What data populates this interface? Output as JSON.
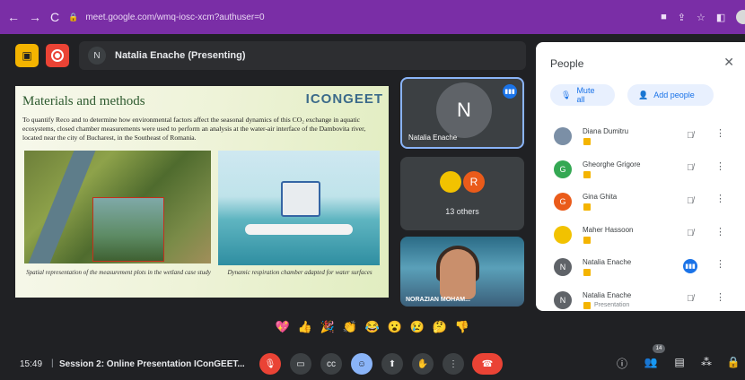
{
  "browser": {
    "url": "meet.google.com/wmq-iosc-xcm?authuser=0",
    "back": "←",
    "forward": "→",
    "reload": "C"
  },
  "meet": {
    "presenter_initial": "N",
    "presenter_label": "Natalia Enache (Presenting)"
  },
  "slide": {
    "title": "Materials and methods",
    "logo": "ICONGEET",
    "body": "To quantify Reco and to determine how environmental factors affect the seasonal dynamics of this CO₂ exchange in aquatic ecosystems, closed chamber measurements were used to perform an analysis at the water-air interface of the Dambovita river, located near the city of Bucharest, in the Southeast of Romania.",
    "caption_left": "Spatial representation of the measurement plots in the wetland case study",
    "caption_right": "Dynamic respiration chamber adapted for water surfaces"
  },
  "tiles": {
    "main_initial": "N",
    "main_name": "Natalia Enache",
    "others_initial": "R",
    "others_count": "13 others",
    "video_name": "NORAZIAN MOHAM..."
  },
  "people_panel": {
    "title": "People",
    "mute_all": "Mute all",
    "add_people": "Add people",
    "participants": [
      {
        "name": "Diana Dumitru",
        "initial": "",
        "color": "#7b8fa6",
        "mic": "muted",
        "sub": ""
      },
      {
        "name": "Gheorghe Grigore",
        "initial": "G",
        "color": "#34a853",
        "mic": "muted",
        "sub": ""
      },
      {
        "name": "Gina Ghita",
        "initial": "G",
        "color": "#ea5b1a",
        "mic": "muted",
        "sub": ""
      },
      {
        "name": "Maher Hassoon",
        "initial": "",
        "color": "#f2c200",
        "mic": "muted",
        "sub": ""
      },
      {
        "name": "Natalia Enache",
        "initial": "N",
        "color": "#5f6368",
        "mic": "active",
        "sub": ""
      },
      {
        "name": "Natalia Enache",
        "initial": "N",
        "color": "#5f6368",
        "mic": "muted",
        "sub": "Presentation"
      }
    ]
  },
  "reactions": [
    "💖",
    "👍",
    "🎉",
    "👏",
    "😂",
    "😮",
    "😢",
    "🤔",
    "👎"
  ],
  "bottom": {
    "time": "15:49",
    "separator": "|",
    "meeting_title": "Session 2: Online Presentation IConGEET...",
    "people_count": "14"
  }
}
